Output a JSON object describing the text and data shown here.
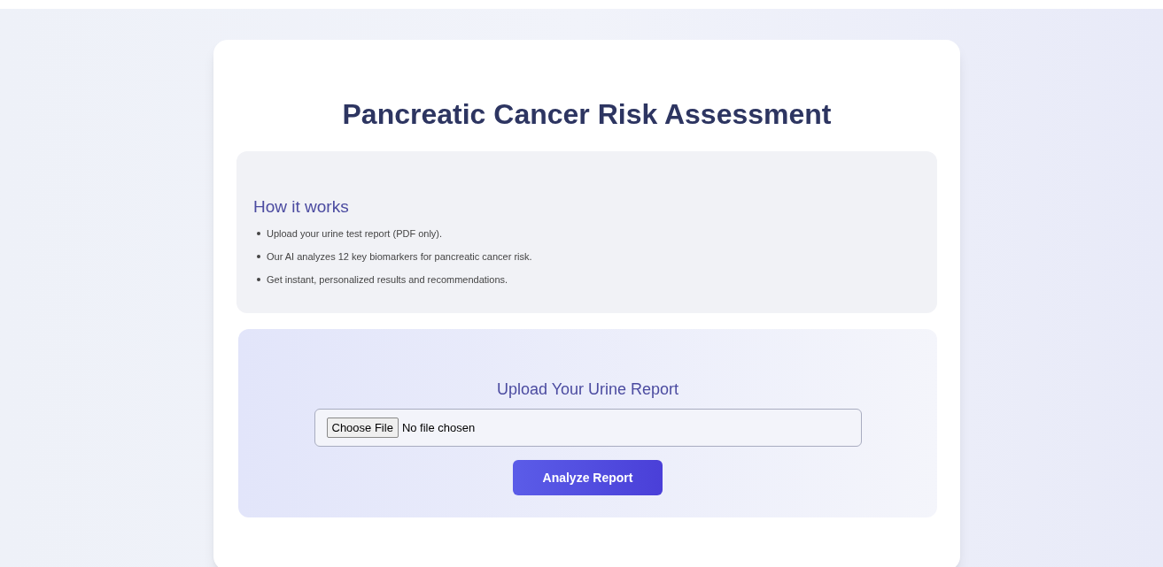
{
  "title": "Pancreatic Cancer Risk Assessment",
  "info": {
    "heading": "How it works",
    "items": [
      "Upload your urine test report (PDF only).",
      "Our AI analyzes 12 key biomarkers for pancreatic cancer risk.",
      "Get instant, personalized results and recommendations."
    ]
  },
  "upload": {
    "heading": "Upload Your Urine Report",
    "file_button": "Choose File",
    "file_status": "No file chosen",
    "submit": "Analyze Report"
  }
}
